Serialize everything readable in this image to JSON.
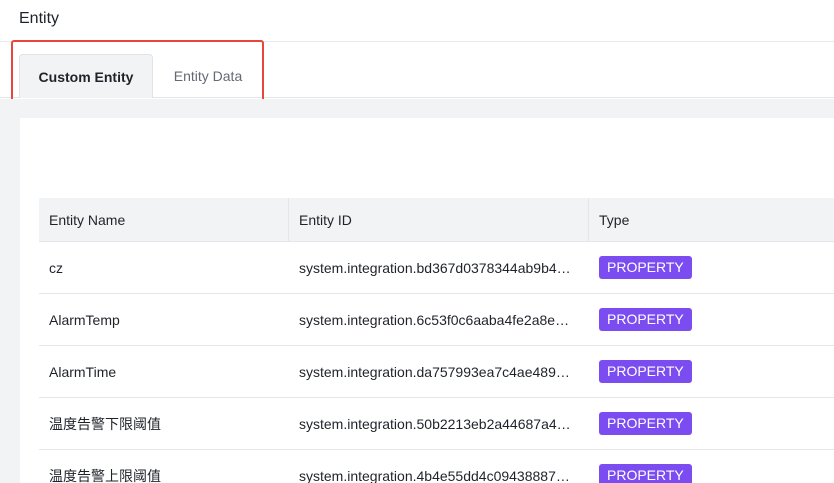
{
  "page": {
    "title": "Entity"
  },
  "tabs": [
    {
      "label": "Custom Entity",
      "active": true
    },
    {
      "label": "Entity Data",
      "active": false
    }
  ],
  "table": {
    "headers": [
      "Entity Name",
      "Entity ID",
      "Type"
    ],
    "rows": [
      {
        "name": "cz",
        "id": "system.integration.bd367d0378344ab9b4…",
        "type": "PROPERTY"
      },
      {
        "name": "AlarmTemp",
        "id": "system.integration.6c53f0c6aaba4fe2a8e…",
        "type": "PROPERTY"
      },
      {
        "name": "AlarmTime",
        "id": "system.integration.da757993ea7c4ae489…",
        "type": "PROPERTY"
      },
      {
        "name": "温度告警下限阈值",
        "id": "system.integration.50b2213eb2a44687a4…",
        "type": "PROPERTY"
      },
      {
        "name": "温度告警上限阈值",
        "id": "system.integration.4b4e55dd4c09438887…",
        "type": "PROPERTY"
      }
    ]
  },
  "colors": {
    "badge": "#7b4df1",
    "highlight_box": "#e8453c"
  }
}
